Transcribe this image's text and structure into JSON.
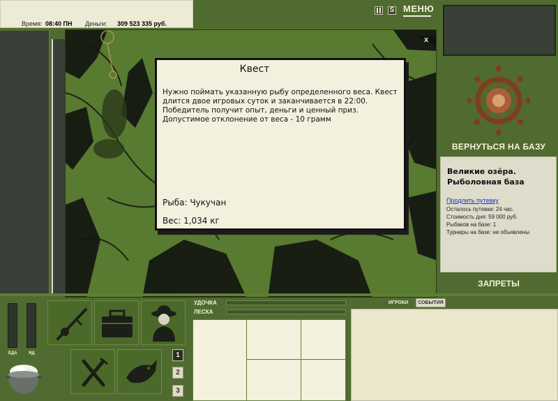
{
  "status": {
    "time_label": "Время:",
    "time_value": "08:40 ПН",
    "money_label": "Деньги:",
    "money_value": "309 523 335 руб."
  },
  "toolbar": {
    "pause_icon": "pause-icon",
    "sound_icon": "sound-icon",
    "menu_label": "МЕНЮ"
  },
  "quest": {
    "close_label": "x",
    "title": "Квест",
    "description": "Нужно поймать указанную рыбу определенного веса. Квест длится двое игровых суток и заканчивается в 22:00. Победитель получит опыт, деньги и ценный приз. Допустимое отклонение от веса - 10 грамм",
    "fish": "Рыба: Чукучан",
    "weight": "Вес: 1,034 кг"
  },
  "sidebar": {
    "return_label": "ВЕРНУТЬСЯ НА БАЗУ",
    "base_title": "Великие озёра. Рыболовная база",
    "extend_link": "Продлить путевку",
    "lines": [
      "Осталось путевки: 24 час.",
      "Стоимость дня: 59 000 руб.",
      "Рыбаков на базе: 1",
      "Турниры на базе: не объявлены"
    ],
    "bans_label": "ЗАПРЕТЫ"
  },
  "needs": {
    "food_label": "ЕДА",
    "poison_label": "ЯД"
  },
  "tackle": {
    "rod_label": "УДОЧКА",
    "line_label": "ЛЕСКА"
  },
  "pages": [
    "1",
    "2",
    "3"
  ],
  "tabs": {
    "players_label": "ИГРОКИ",
    "events_label": "СОБЫТИЯ"
  },
  "colors": {
    "background": "#4f6b2f",
    "card": "#f3f1de",
    "link": "#1133cc"
  }
}
